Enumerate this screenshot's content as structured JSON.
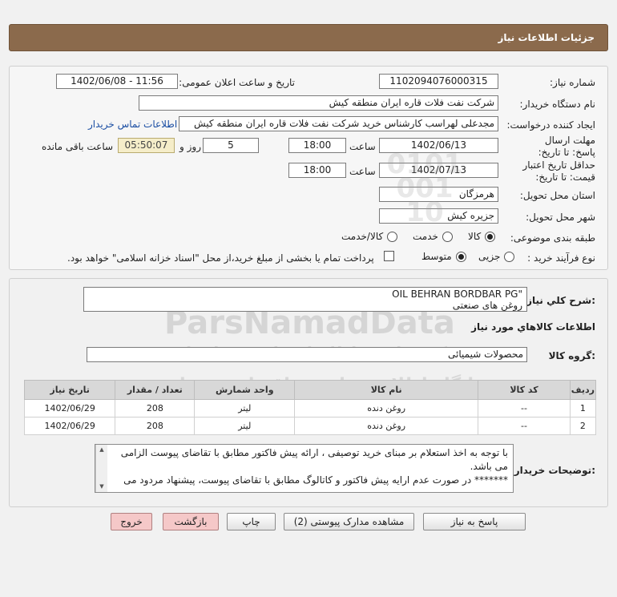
{
  "header": {
    "title": "جزئیات اطلاعات نیاز"
  },
  "form": {
    "need_number_label": "شماره نیاز:",
    "need_number": "1102094076000315",
    "announce_label": "تاریخ و ساعت اعلان عمومی:",
    "announce_value": "1402/06/08 - 11:56",
    "buyer_label": "نام دستگاه خریدار:",
    "buyer_value": "شرکت نفت فلات قاره ایران منطقه کیش",
    "creator_label": "ایجاد کننده درخواست:",
    "creator_value": "مجدعلی لهراسب کارشناس خرید شرکت نفت فلات قاره ایران منطقه کیش",
    "contact_link": "اطلاعات تماس خریدار",
    "deadline_label": "مهلت ارسال پاسخ: تا تاریخ:",
    "deadline_date": "1402/06/13",
    "time_label": "ساعت",
    "deadline_time": "18:00",
    "days_value": "5",
    "days_label": "روز و",
    "remaining_time": "05:50:07",
    "remaining_label": "ساعت باقی مانده",
    "validity_label": "حداقل تاریخ اعتبار قیمت: تا تاریخ:",
    "validity_date": "1402/07/13",
    "validity_time": "18:00",
    "province_label": "استان محل تحویل:",
    "province_value": "هرمزگان",
    "city_label": "شهر محل تحویل:",
    "city_value": "جزیره کیش",
    "category_label": "طبقه بندی موضوعی:",
    "category_options": [
      "کالا",
      "خدمت",
      "کالا/خدمت"
    ],
    "category_selected": "کالا",
    "process_label": "نوع فرآیند خرید :",
    "process_options": [
      "جزیی",
      "متوسط"
    ],
    "process_selected": "متوسط",
    "payment_note": "پرداخت تمام یا بخشی از مبلغ خرید،از محل \"اسناد خزانه اسلامی\" خواهد بود."
  },
  "details": {
    "summary_label": "شرح کلي نياز:",
    "summary_line1": "OIL  BEHRAN BORDBAR PG\"",
    "summary_line2": "روغن های صنعتی",
    "goods_info_title": "اطلاعات کالاهاي مورد نياز",
    "goods_group_label": "گروه کالا:",
    "goods_group_value": "محصولات شیمیائی",
    "table": {
      "headers": [
        "ردیف",
        "کد کالا",
        "نام کالا",
        "واحد شمارش",
        "تعداد / مقدار",
        "تاریخ نیاز"
      ],
      "rows": [
        [
          "1",
          "--",
          "روغن دنده",
          "لیتر",
          "208",
          "1402/06/29"
        ],
        [
          "2",
          "--",
          "روغن دنده",
          "لیتر",
          "208",
          "1402/06/29"
        ]
      ]
    },
    "notes_label": "توضیحات خریدار:",
    "notes_line1": "با توجه به اخذ استعلام بر مبنای خرید توصیفی ، ارائه پیش فاکتور مطابق با تقاضای پیوست الزامی",
    "notes_line2": "می باشد.",
    "notes_line3": "******* در صورت عدم ارایه پیش فاکتور و کاتالوگ مطابق با تقاضای پیوست، پیشنهاد مردود می"
  },
  "buttons": {
    "reply": "پاسخ به نیاز",
    "view_docs": "مشاهده مدارک پیوستی (2)",
    "print": "چاپ",
    "back": "بازگشت",
    "exit": "خروج"
  },
  "watermark": {
    "brand": "ParsNamadData",
    "line1": "مرکز فراوری اطلاعات پارس نماد داده",
    "line2": "پایگاه اطلاع رسانی مناقصات و مزایده",
    "phone": "۰۲۱-۸۸۳۴۹۶۷۰-۵",
    "stamp": "0101 001 10"
  },
  "colors": {
    "header": "#8b6a4c",
    "link": "#1b4ea3",
    "remaining_bg": "#f5edc9",
    "exit_bg": "#f5c8c8"
  }
}
